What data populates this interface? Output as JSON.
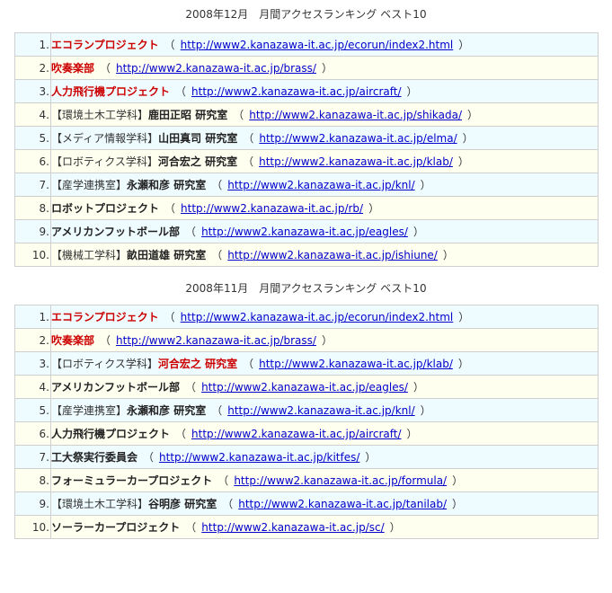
{
  "sections": [
    {
      "title": "2008年12月　月間アクセスランキング ベスト10",
      "rows": [
        {
          "rank": "1.",
          "tag": "",
          "name": "エコランプロジェクト",
          "highlight": true,
          "url": "http://www2.kanazawa-it.ac.jp/ecorun/index2.html"
        },
        {
          "rank": "2.",
          "tag": "",
          "name": "吹奏楽部",
          "highlight": true,
          "url": "http://www2.kanazawa-it.ac.jp/brass/"
        },
        {
          "rank": "3.",
          "tag": "",
          "name": "人力飛行機プロジェクト",
          "highlight": true,
          "url": "http://www2.kanazawa-it.ac.jp/aircraft/"
        },
        {
          "rank": "4.",
          "tag": "【環境土木工学科】",
          "name": "鹿田正昭 研究室",
          "highlight": false,
          "url": "http://www2.kanazawa-it.ac.jp/shikada/"
        },
        {
          "rank": "5.",
          "tag": "【メディア情報学科】",
          "name": "山田真司 研究室",
          "highlight": false,
          "url": "http://www2.kanazawa-it.ac.jp/elma/"
        },
        {
          "rank": "6.",
          "tag": "【ロボティクス学科】",
          "name": "河合宏之 研究室",
          "highlight": false,
          "url": "http://www2.kanazawa-it.ac.jp/klab/"
        },
        {
          "rank": "7.",
          "tag": "【産学連携室】",
          "name": "永瀬和彦 研究室",
          "highlight": false,
          "url": "http://www2.kanazawa-it.ac.jp/knl/"
        },
        {
          "rank": "8.",
          "tag": "",
          "name": "ロボットプロジェクト",
          "highlight": false,
          "url": "http://www2.kanazawa-it.ac.jp/rb/"
        },
        {
          "rank": "9.",
          "tag": "",
          "name": "アメリカンフットボール部",
          "highlight": false,
          "url": "http://www2.kanazawa-it.ac.jp/eagles/"
        },
        {
          "rank": "10.",
          "tag": "【機械工学科】",
          "name": "畝田道雄 研究室",
          "highlight": false,
          "url": "http://www2.kanazawa-it.ac.jp/ishiune/"
        }
      ]
    },
    {
      "title": "2008年11月　月間アクセスランキング ベスト10",
      "rows": [
        {
          "rank": "1.",
          "tag": "",
          "name": "エコランプロジェクト",
          "highlight": true,
          "url": "http://www2.kanazawa-it.ac.jp/ecorun/index2.html"
        },
        {
          "rank": "2.",
          "tag": "",
          "name": "吹奏楽部",
          "highlight": true,
          "url": "http://www2.kanazawa-it.ac.jp/brass/"
        },
        {
          "rank": "3.",
          "tag": "【ロボティクス学科】",
          "name": "河合宏之 研究室",
          "highlight": true,
          "url": "http://www2.kanazawa-it.ac.jp/klab/"
        },
        {
          "rank": "4.",
          "tag": "",
          "name": "アメリカンフットボール部",
          "highlight": false,
          "url": "http://www2.kanazawa-it.ac.jp/eagles/"
        },
        {
          "rank": "5.",
          "tag": "【産学連携室】",
          "name": "永瀬和彦 研究室",
          "highlight": false,
          "url": "http://www2.kanazawa-it.ac.jp/knl/"
        },
        {
          "rank": "6.",
          "tag": "",
          "name": "人力飛行機プロジェクト",
          "highlight": false,
          "url": "http://www2.kanazawa-it.ac.jp/aircraft/"
        },
        {
          "rank": "7.",
          "tag": "",
          "name": "工大祭実行委員会",
          "highlight": false,
          "url": "http://www2.kanazawa-it.ac.jp/kitfes/"
        },
        {
          "rank": "8.",
          "tag": "",
          "name": "フォーミュラーカープロジェクト",
          "highlight": false,
          "url": "http://www2.kanazawa-it.ac.jp/formula/"
        },
        {
          "rank": "9.",
          "tag": "【環境土木工学科】",
          "name": "谷明彦 研究室",
          "highlight": false,
          "url": "http://www2.kanazawa-it.ac.jp/tanilab/"
        },
        {
          "rank": "10.",
          "tag": "",
          "name": "ソーラーカープロジェクト",
          "highlight": false,
          "url": "http://www2.kanazawa-it.ac.jp/sc/"
        }
      ]
    }
  ],
  "punctuation": {
    "open": "（",
    "close": "）"
  },
  "colors": {
    "highlight_name": "#cc0000",
    "link": "#0000cc",
    "row_odd": "#eefbff",
    "row_even": "#fffff0",
    "border": "#cfcfcf"
  }
}
